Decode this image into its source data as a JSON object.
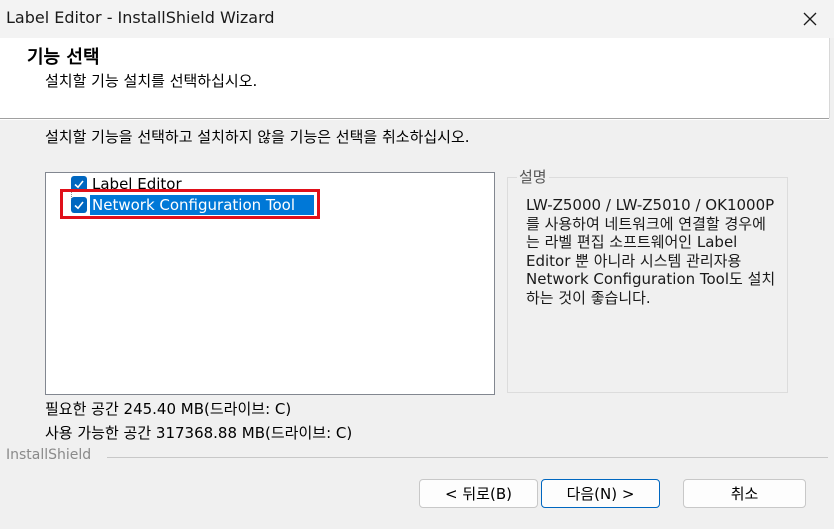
{
  "window": {
    "title": "Label Editor - InstallShield Wizard",
    "close_icon": "close-icon"
  },
  "header": {
    "title": "기능 선택",
    "subtitle": "설치할 기능 설치를 선택하십시오."
  },
  "instruction": "설치할 기능을 선택하고 설치하지 않을 기능은 선택을 취소하십시오.",
  "features": [
    {
      "label": "Label Editor",
      "checked": true,
      "selected": false
    },
    {
      "label": "Network Configuration Tool",
      "checked": true,
      "selected": true
    }
  ],
  "description": {
    "legend": "설명",
    "text": "LW-Z5000 / LW-Z5010 / OK1000P를 사용하여 네트워크에 연결할 경우에는 라벨 편집 소프트웨어인 Label Editor 뿐 아니라 시스템 관리자용 Network Configuration Tool도 설치하는 것이 좋습니다."
  },
  "space": {
    "required": "필요한 공간 245.40 MB(드라이브: C)",
    "available": "사용 가능한 공간 317368.88 MB(드라이브: C)"
  },
  "brand": "InstallShield",
  "buttons": {
    "back": "< 뒤로(B)",
    "next": "다음(N) >",
    "cancel": "취소"
  },
  "colors": {
    "checkbox": "#0067c0",
    "selection": "#0078d7",
    "highlight_box": "#e0101a"
  }
}
